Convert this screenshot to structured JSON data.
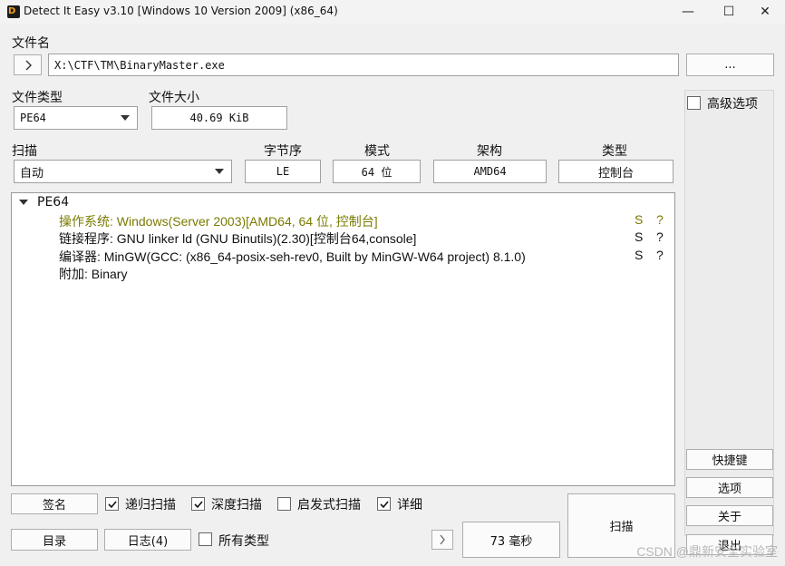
{
  "window": {
    "title": "Detect It Easy v3.10 [Windows 10 Version 2009] (x86_64)",
    "minimize": "—",
    "maximize": "☐",
    "close": "✕"
  },
  "file": {
    "label": "文件名",
    "path": "X:\\CTF\\TM\\BinaryMaster.exe",
    "browse_label": "..."
  },
  "file_type": {
    "label": "文件类型",
    "value": "PE64"
  },
  "file_size": {
    "label": "文件大小",
    "value": "40.69 KiB"
  },
  "scan": {
    "label": "扫描",
    "value": "自动"
  },
  "info": {
    "endian_label": "字节序",
    "endian_value": "LE",
    "mode_label": "模式",
    "mode_value": "64 位",
    "arch_label": "架构",
    "arch_value": "AMD64",
    "type_label": "类型",
    "type_value": "控制台"
  },
  "result": {
    "root": "PE64",
    "rows": [
      {
        "text": "操作系统: Windows(Server 2003)[AMD64, 64 位, 控制台]",
        "s": "S",
        "q": "?",
        "color": "#7a7a00"
      },
      {
        "text": "链接程序: GNU linker ld (GNU Binutils)(2.30)[控制台64,console]",
        "s": "S",
        "q": "?",
        "color": "#111111"
      },
      {
        "text": "编译器: MinGW(GCC: (x86_64-posix-seh-rev0, Built by MinGW-W64 project) 8.1.0)",
        "s": "S",
        "q": "?",
        "color": "#111111"
      },
      {
        "text": "附加: Binary",
        "s": "",
        "q": "",
        "color": "#111111"
      }
    ]
  },
  "side": {
    "advanced_label": "高级选项",
    "shortcuts": "快捷键",
    "options": "选项",
    "about": "关于",
    "exit": "退出"
  },
  "bottom": {
    "signature": "签名",
    "recursive": "递归扫描",
    "deep": "深度扫描",
    "heuristic": "启发式扫描",
    "verbose": "详细",
    "directory": "目录",
    "log": "日志(4)",
    "all_types": "所有类型",
    "time": "73 毫秒",
    "scan_button": "扫描",
    "next_symbol": "›"
  },
  "checks": {
    "recursive": true,
    "deep": true,
    "heuristic": false,
    "verbose": true,
    "all_types": false,
    "advanced": false
  },
  "watermark": "CSDN @鼎新安全实验室"
}
